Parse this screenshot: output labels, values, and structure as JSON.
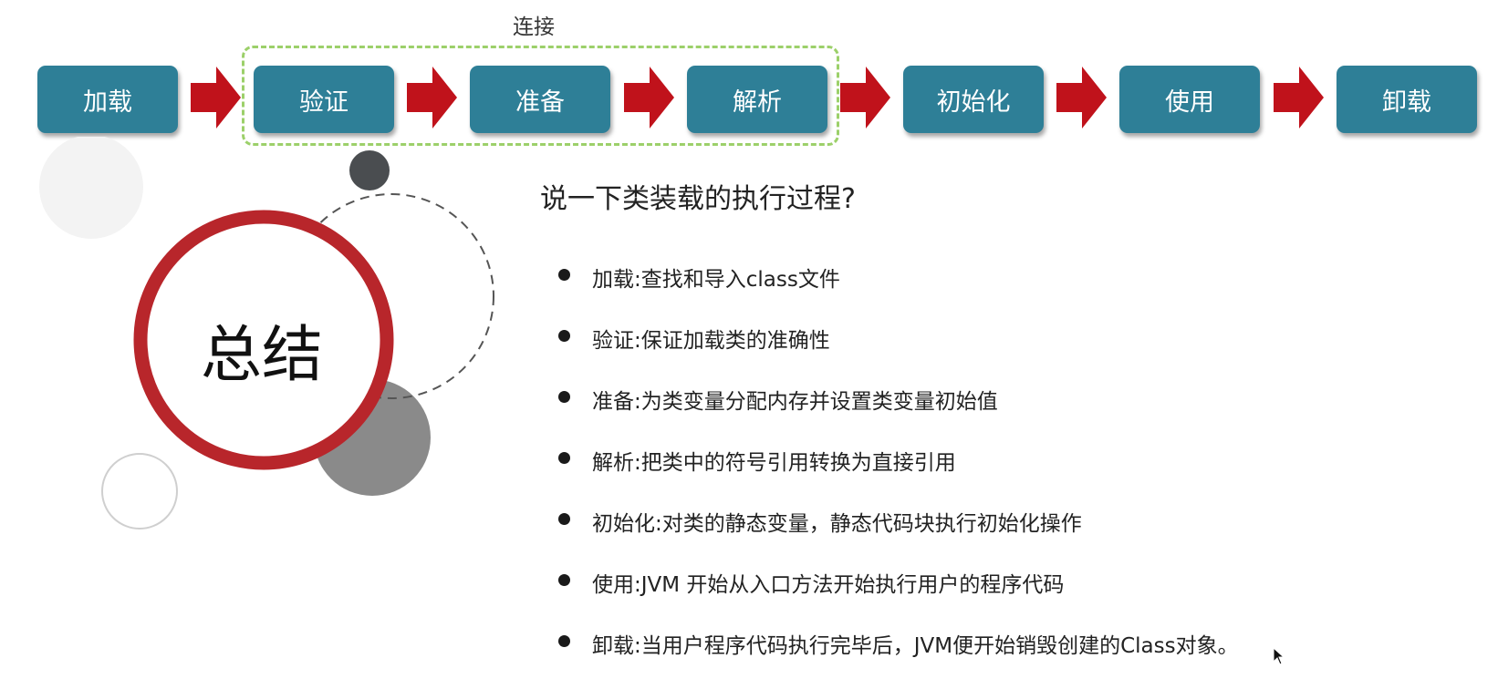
{
  "group_label": "连接",
  "stages": [
    {
      "label": "加载"
    },
    {
      "label": "验证"
    },
    {
      "label": "准备"
    },
    {
      "label": "解析"
    },
    {
      "label": "初始化"
    },
    {
      "label": "使用"
    },
    {
      "label": "卸载"
    }
  ],
  "summary_title": "总结",
  "question": "说一下类装载的执行过程?",
  "steps": [
    "加载:查找和导入class文件",
    "验证:保证加载类的准确性",
    "准备:为类变量分配内存并设置类变量初始值",
    "解析:把类中的符号引用转换为直接引用",
    "初始化:对类的静态变量，静态代码块执行初始化操作",
    "使用:JVM 开始从入口方法开始执行用户的程序代码",
    "卸载:当用户程序代码执行完毕后，JVM便开始销毁创建的Class对象。"
  ],
  "colors": {
    "stage_fill": "#2e7f97",
    "arrow_fill": "#c0121b",
    "group_border": "#9cd06a",
    "ring": "#b8262b"
  }
}
